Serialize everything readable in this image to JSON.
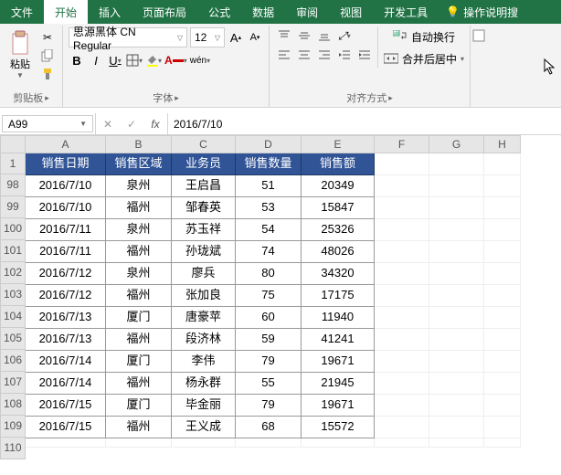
{
  "menu": {
    "file": "文件",
    "home": "开始",
    "insert": "插入",
    "layout": "页面布局",
    "formula": "公式",
    "data": "数据",
    "review": "审阅",
    "view": "视图",
    "dev": "开发工具",
    "tellme": "操作说明搜"
  },
  "ribbon": {
    "clipboard": {
      "paste": "粘贴",
      "label": "剪贴板"
    },
    "font": {
      "name": "思源黑体 CN Regular",
      "size": "12",
      "label": "字体",
      "wen": "wén"
    },
    "align": {
      "wrap": "自动换行",
      "merge": "合并后居中",
      "label": "对齐方式"
    }
  },
  "namebox": "A99",
  "formula": "2016/7/10",
  "cols": [
    "A",
    "B",
    "C",
    "D",
    "E",
    "F",
    "G",
    "H"
  ],
  "header_row": "1",
  "headers": [
    "销售日期",
    "销售区域",
    "业务员",
    "销售数量",
    "销售额"
  ],
  "row_nums": [
    "98",
    "99",
    "100",
    "101",
    "102",
    "103",
    "104",
    "105",
    "106",
    "107",
    "108",
    "109",
    "110"
  ],
  "rows": [
    [
      "2016/7/10",
      "泉州",
      "王启昌",
      "51",
      "20349"
    ],
    [
      "2016/7/10",
      "福州",
      "邹春英",
      "53",
      "15847"
    ],
    [
      "2016/7/11",
      "泉州",
      "苏玉祥",
      "54",
      "25326"
    ],
    [
      "2016/7/11",
      "福州",
      "孙珑斌",
      "74",
      "48026"
    ],
    [
      "2016/7/12",
      "泉州",
      "廖兵",
      "80",
      "34320"
    ],
    [
      "2016/7/12",
      "福州",
      "张加良",
      "75",
      "17175"
    ],
    [
      "2016/7/13",
      "厦门",
      "唐豪苹",
      "60",
      "11940"
    ],
    [
      "2016/7/13",
      "福州",
      "段济林",
      "59",
      "41241"
    ],
    [
      "2016/7/14",
      "厦门",
      "李伟",
      "79",
      "19671"
    ],
    [
      "2016/7/14",
      "福州",
      "杨永群",
      "55",
      "21945"
    ],
    [
      "2016/7/15",
      "厦门",
      "毕金丽",
      "79",
      "19671"
    ],
    [
      "2016/7/15",
      "福州",
      "王义成",
      "68",
      "15572"
    ]
  ]
}
